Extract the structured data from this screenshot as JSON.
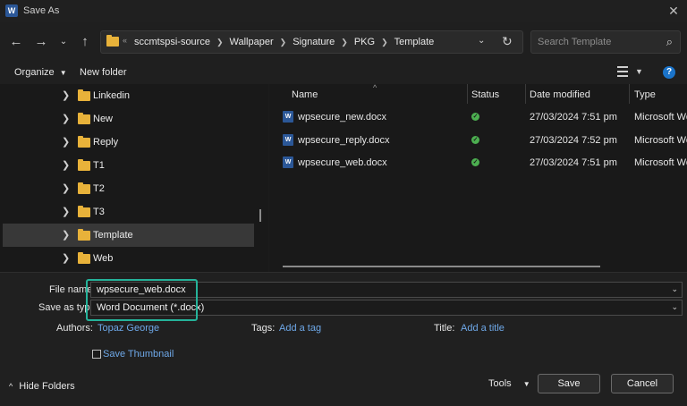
{
  "window": {
    "title": "Save As",
    "app_icon": "W"
  },
  "address": {
    "overflow": "«",
    "crumbs": [
      "sccmtspsi-source",
      "Wallpaper",
      "Signature",
      "PKG",
      "Template"
    ]
  },
  "search": {
    "placeholder": "Search Template"
  },
  "commands": {
    "organize": "Organize",
    "new_folder": "New folder",
    "help": "?"
  },
  "nav_tree": [
    {
      "label": "Linkedin"
    },
    {
      "label": "New"
    },
    {
      "label": "Reply"
    },
    {
      "label": "T1"
    },
    {
      "label": "T2"
    },
    {
      "label": "T3"
    },
    {
      "label": "Template",
      "selected": true
    },
    {
      "label": "Web"
    }
  ],
  "columns": {
    "name": "Name",
    "status": "Status",
    "date_modified": "Date modified",
    "type": "Type"
  },
  "files": [
    {
      "name": "wpsecure_new.docx",
      "date": "27/03/2024 7:51 pm",
      "type": "Microsoft Wo"
    },
    {
      "name": "wpsecure_reply.docx",
      "date": "27/03/2024 7:52 pm",
      "type": "Microsoft Wo"
    },
    {
      "name": "wpsecure_web.docx",
      "date": "27/03/2024 7:51 pm",
      "type": "Microsoft Wo"
    }
  ],
  "form": {
    "file_name_label": "File name:",
    "file_name_value": "wpsecure_web.docx",
    "save_as_type_label": "Save as type:",
    "save_as_type_value": "Word Document (*.docx)",
    "authors_label": "Authors:",
    "authors_value": "Topaz George",
    "tags_label": "Tags:",
    "tags_value": "Add a tag",
    "title_label": "Title:",
    "title_value": "Add a title",
    "thumbnail_label": "Save Thumbnail"
  },
  "footer": {
    "hide_folders": "Hide Folders",
    "tools": "Tools",
    "save": "Save",
    "cancel": "Cancel"
  },
  "colors": {
    "accent_highlight": "#25b39a",
    "link": "#6ea8e8",
    "folder": "#e8b23a",
    "status_ok": "#4caf50"
  }
}
